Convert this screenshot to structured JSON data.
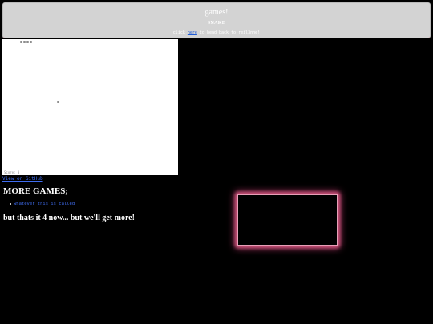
{
  "header": {
    "title": "games!",
    "subtitle": "SNAKE",
    "back_prefix": "click ",
    "back_link": "here",
    "back_suffix": " to head back to reil3nne!"
  },
  "game": {
    "score_text": "Score: 0",
    "canvas_color": "#ffffff",
    "snake_color": "#8e8e8e",
    "snake_length": 4
  },
  "github_link": "View on GitHub",
  "more_games": {
    "heading": "MORE GAMES;",
    "items": [
      {
        "label": "whatever this is called"
      }
    ]
  },
  "footer_note": "but thats it 4 now... but we'll get more!",
  "colors": {
    "background": "#000000",
    "banner": "#d3d3d3",
    "link": "#3f6df0",
    "frame_glow": "#d0557d"
  }
}
